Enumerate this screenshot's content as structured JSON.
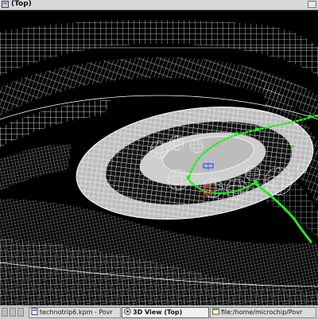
{
  "window": {
    "title": "(Top)"
  },
  "viewport": {
    "view_name": "3D View (Top)",
    "colors": {
      "background": "#000000",
      "mesh": "#ffffff",
      "floor": "#bdbdbd",
      "path": "#22ee22",
      "camera_marker": "#ff2020",
      "light_marker": "#3050ff"
    }
  },
  "taskbar": {
    "items": [
      {
        "label": "technotrip6.kpm - Povr",
        "icon": "document-icon"
      },
      {
        "label": "3D View (Top)",
        "icon": "view-3d-icon",
        "active": true
      },
      {
        "label": "file:/home/microchip/Povr",
        "icon": "browser-icon"
      }
    ]
  }
}
